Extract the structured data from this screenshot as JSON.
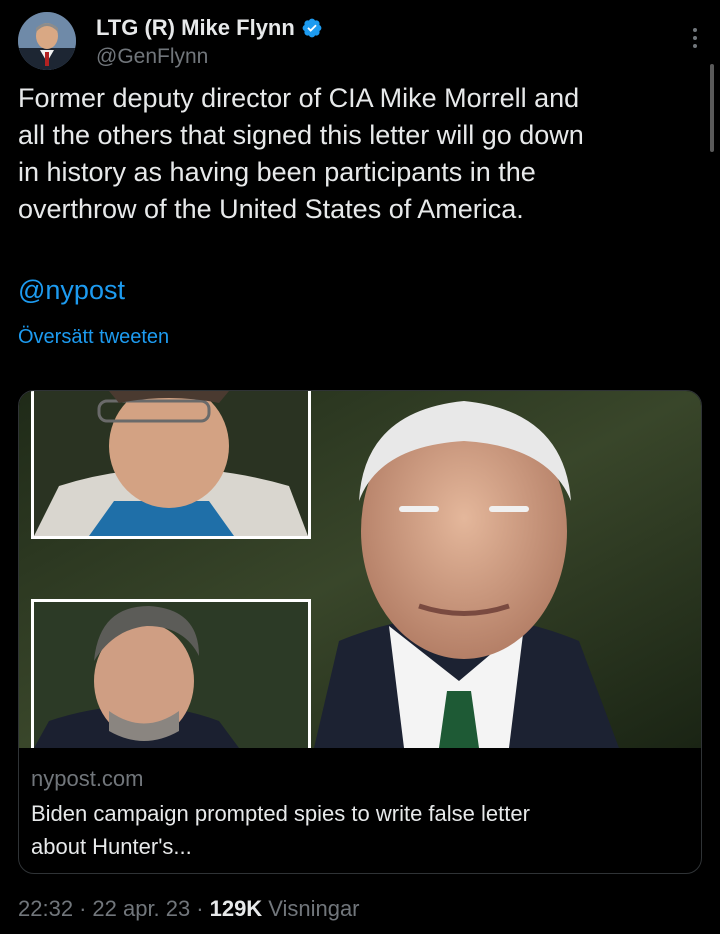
{
  "author": {
    "display_name": "LTG (R) Mike Flynn",
    "handle": "@GenFlynn",
    "verified_color": "#1d9bf0"
  },
  "tweet": {
    "text": "Former deputy director of CIA Mike Morrell and\nall the others that signed this letter will go down\nin history as having been participants in the\noverthrow of the United States of America.",
    "mention": "@nypost",
    "translate_label": "Översätt tweeten"
  },
  "card": {
    "domain": "nypost.com",
    "title": "Biden campaign prompted spies to write false letter\nabout Hunter's..."
  },
  "footer": {
    "time": "22:32",
    "sep1": "·",
    "date": "22 apr. 23",
    "sep2": "·",
    "views_count": "129K",
    "views_label": "Visningar"
  },
  "colors": {
    "background": "#000000",
    "text": "#e7e9ea",
    "secondary": "#71767b",
    "link": "#1d9bf0"
  },
  "icons": {
    "verified": "verified-badge-icon",
    "more": "more-vertical-icon"
  }
}
